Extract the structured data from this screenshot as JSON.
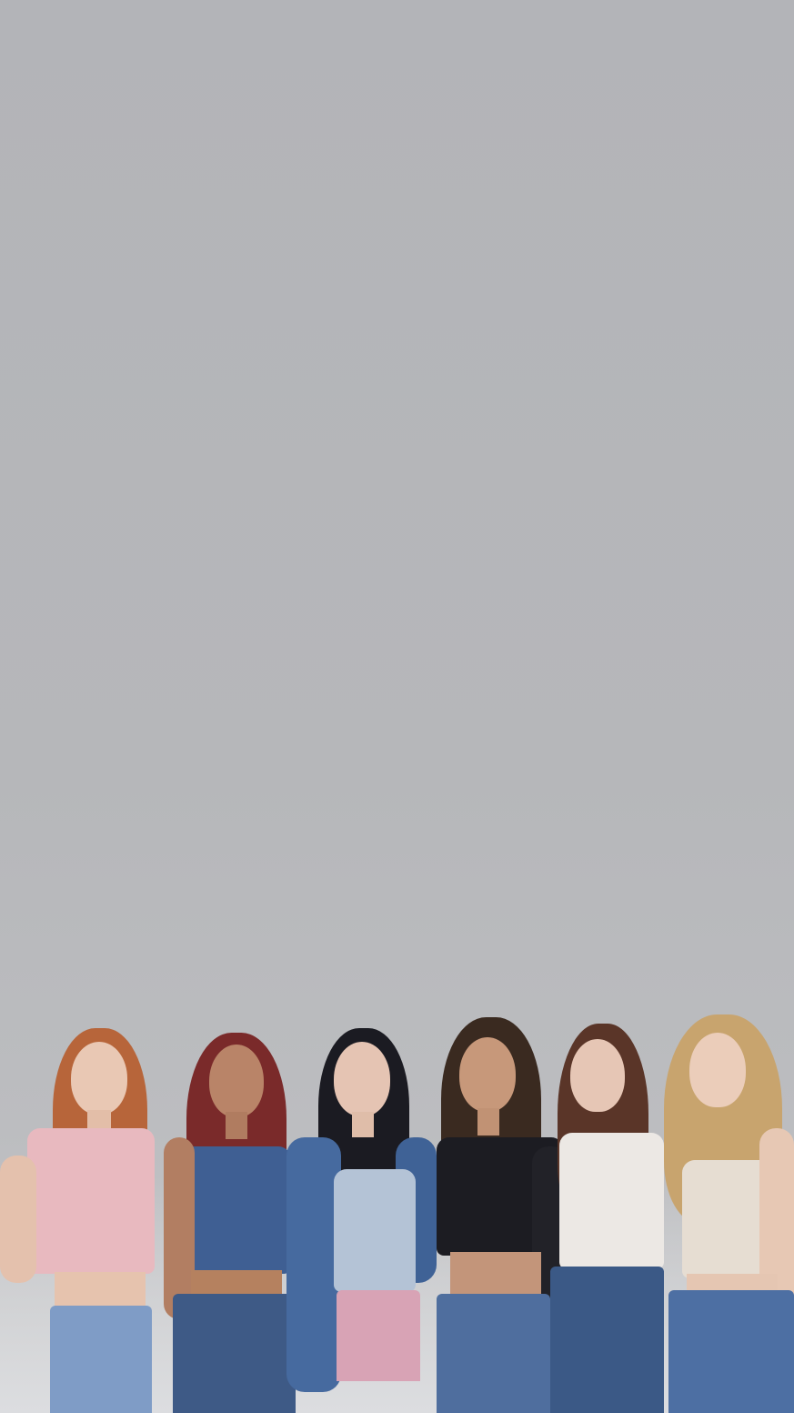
{
  "colors": {
    "backdrop": "#b4b5b8",
    "floor": "#dcdde0",
    "skin_light": "#e8c7b2",
    "skin_tan": "#c99a7c",
    "denim": "#4a6a9a",
    "denim_light": "#6f8fbf"
  },
  "group": {
    "member_count": 6,
    "members": [
      {
        "hair": "copper",
        "top": "pink-lace-crop",
        "bottom": "light-jeans"
      },
      {
        "hair": "red",
        "top": "denim-bustier",
        "bottom": "dark-jeans"
      },
      {
        "hair": "black",
        "top": "denim-jacket-lace-top",
        "bottom": "pink-shorts"
      },
      {
        "hair": "brown-braids",
        "top": "black-crop-leather-belt",
        "bottom": "blue-jeans"
      },
      {
        "hair": "brown",
        "top": "white-graphic-tee",
        "bottom": "dark-jeans"
      },
      {
        "hair": "blonde-waves",
        "top": "white-print-tank",
        "bottom": "blue-jeans"
      }
    ]
  }
}
